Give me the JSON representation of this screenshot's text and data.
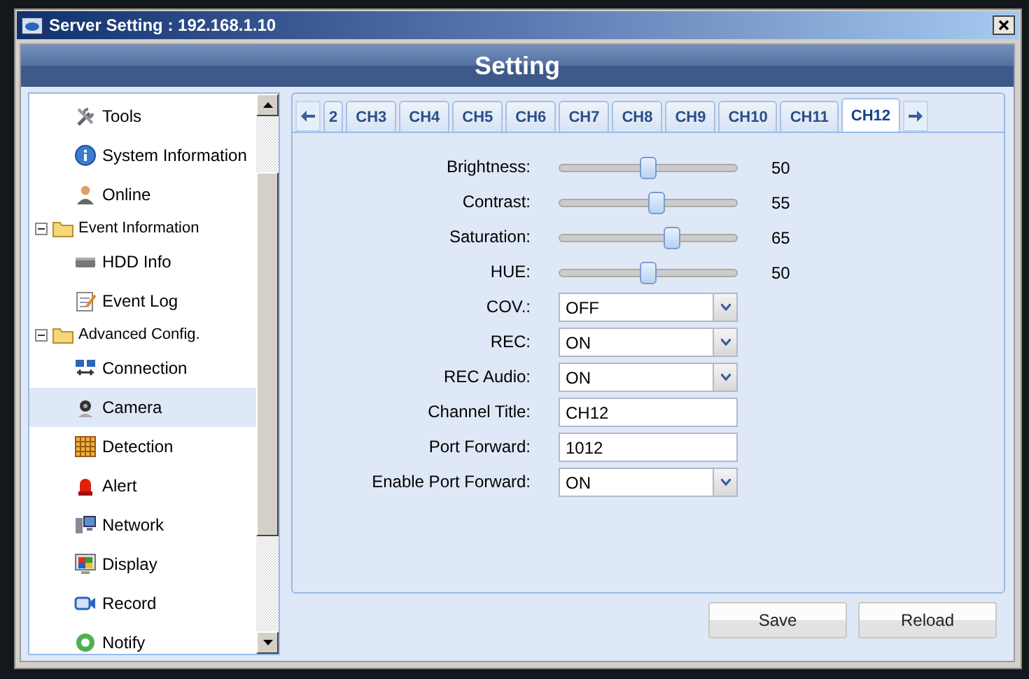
{
  "window": {
    "title": "Server Setting : 192.168.1.10"
  },
  "header": {
    "title": "Setting"
  },
  "sidebar": {
    "items": [
      {
        "label": "Tools",
        "selected": false
      },
      {
        "label": "System Information",
        "selected": false
      },
      {
        "label": "Online",
        "selected": false
      },
      {
        "label": "Event Information",
        "expanded": true,
        "children": [
          {
            "label": "HDD Info",
            "selected": false
          },
          {
            "label": "Event Log",
            "selected": false
          }
        ]
      },
      {
        "label": "Advanced Config.",
        "expanded": true,
        "children": [
          {
            "label": "Connection",
            "selected": false
          },
          {
            "label": "Camera",
            "selected": true
          },
          {
            "label": "Detection",
            "selected": false
          },
          {
            "label": "Alert",
            "selected": false
          },
          {
            "label": "Network",
            "selected": false
          },
          {
            "label": "Display",
            "selected": false
          },
          {
            "label": "Record",
            "selected": false
          },
          {
            "label": "Notify",
            "selected": false
          }
        ]
      }
    ]
  },
  "tabs": [
    {
      "label": "2",
      "selected": false
    },
    {
      "label": "CH3",
      "selected": false
    },
    {
      "label": "CH4",
      "selected": false
    },
    {
      "label": "CH5",
      "selected": false
    },
    {
      "label": "CH6",
      "selected": false
    },
    {
      "label": "CH7",
      "selected": false
    },
    {
      "label": "CH8",
      "selected": false
    },
    {
      "label": "CH9",
      "selected": false
    },
    {
      "label": "CH10",
      "selected": false
    },
    {
      "label": "CH11",
      "selected": false
    },
    {
      "label": "CH12",
      "selected": true
    }
  ],
  "fields": [
    {
      "kind": "slider",
      "label": "Brightness:",
      "level": 0.5,
      "reading": "50"
    },
    {
      "kind": "slider",
      "label": "Contrast:",
      "level": 0.55,
      "reading": "55"
    },
    {
      "kind": "slider",
      "label": "Saturation:",
      "level": 0.65,
      "reading": "65"
    },
    {
      "kind": "slider",
      "label": "HUE:",
      "level": 0.5,
      "reading": "50"
    },
    {
      "kind": "select",
      "label": "COV.:",
      "value": "OFF"
    },
    {
      "kind": "select",
      "label": "REC:",
      "value": "ON"
    },
    {
      "kind": "select",
      "label": "REC Audio:",
      "value": "ON"
    },
    {
      "kind": "text",
      "label": "Channel Title:",
      "value": "CH12"
    },
    {
      "kind": "text",
      "label": "Port Forward:",
      "value": "1012"
    },
    {
      "kind": "select",
      "label": "Enable Port Forward:",
      "value": "ON"
    }
  ],
  "buttons": [
    "Save",
    "Reload"
  ]
}
